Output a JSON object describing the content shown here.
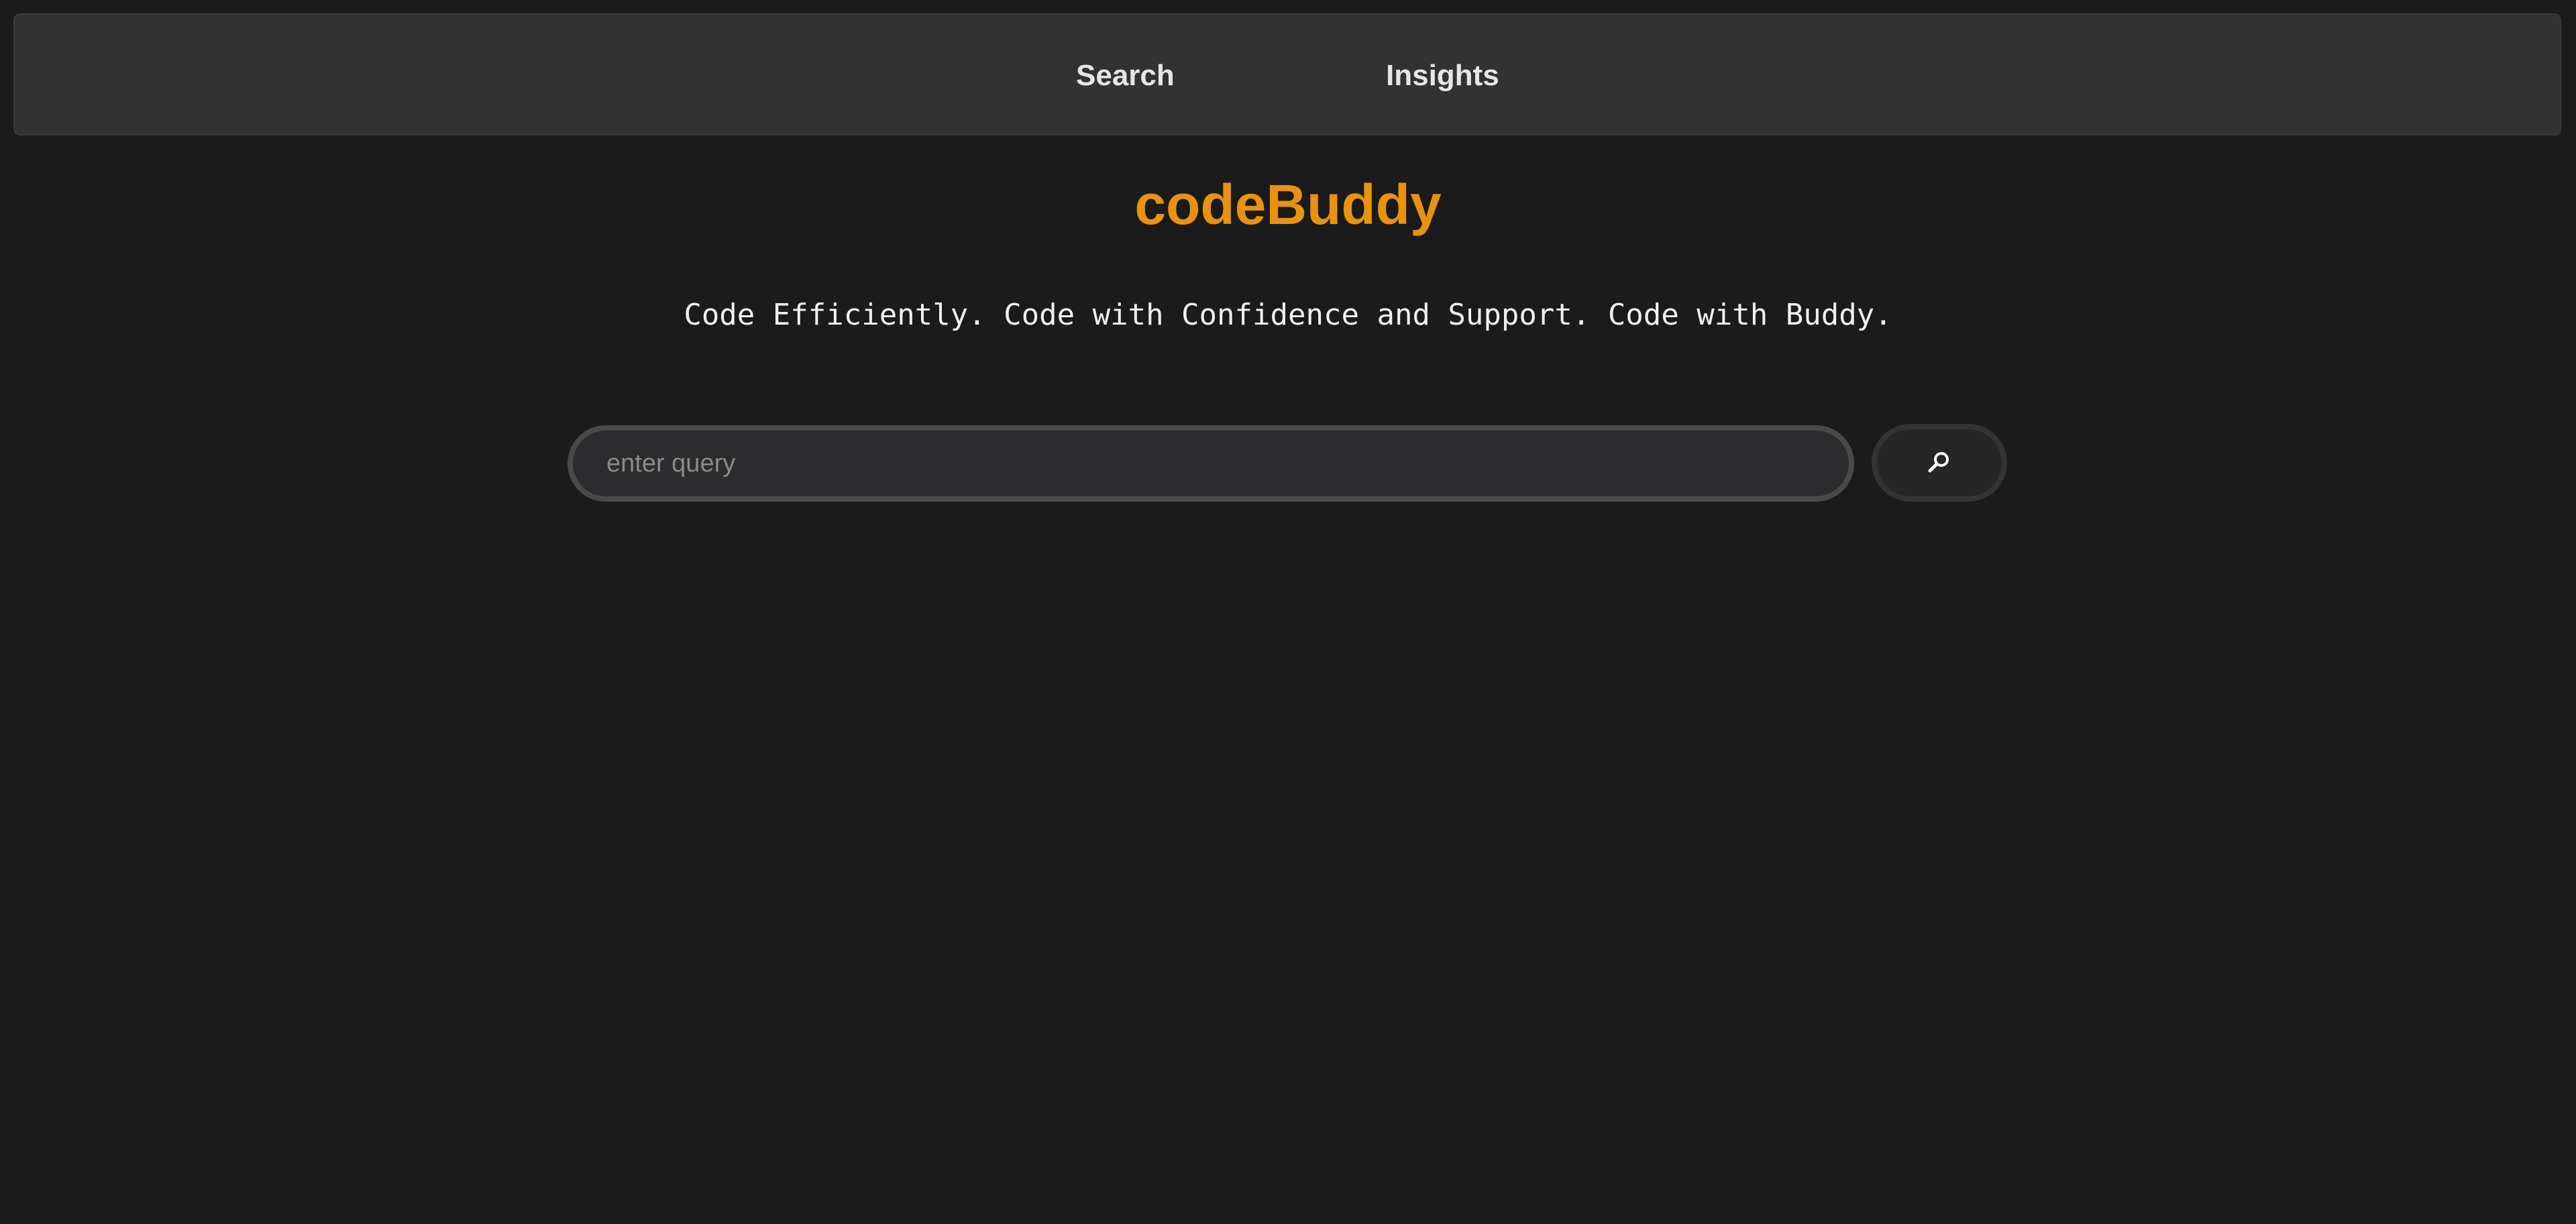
{
  "nav": {
    "items": [
      {
        "label": "Search"
      },
      {
        "label": "Insights"
      }
    ]
  },
  "brand": {
    "title": "codeBuddy",
    "color": "#e8920f"
  },
  "tagline": "Code Efficiently. Code with Confidence and Support. Code with Buddy.",
  "search": {
    "placeholder": "enter query",
    "value": "",
    "button_icon": "search-icon"
  },
  "colors": {
    "background": "#1b1b1b",
    "topbar": "#323232",
    "accent": "#e8920f"
  }
}
